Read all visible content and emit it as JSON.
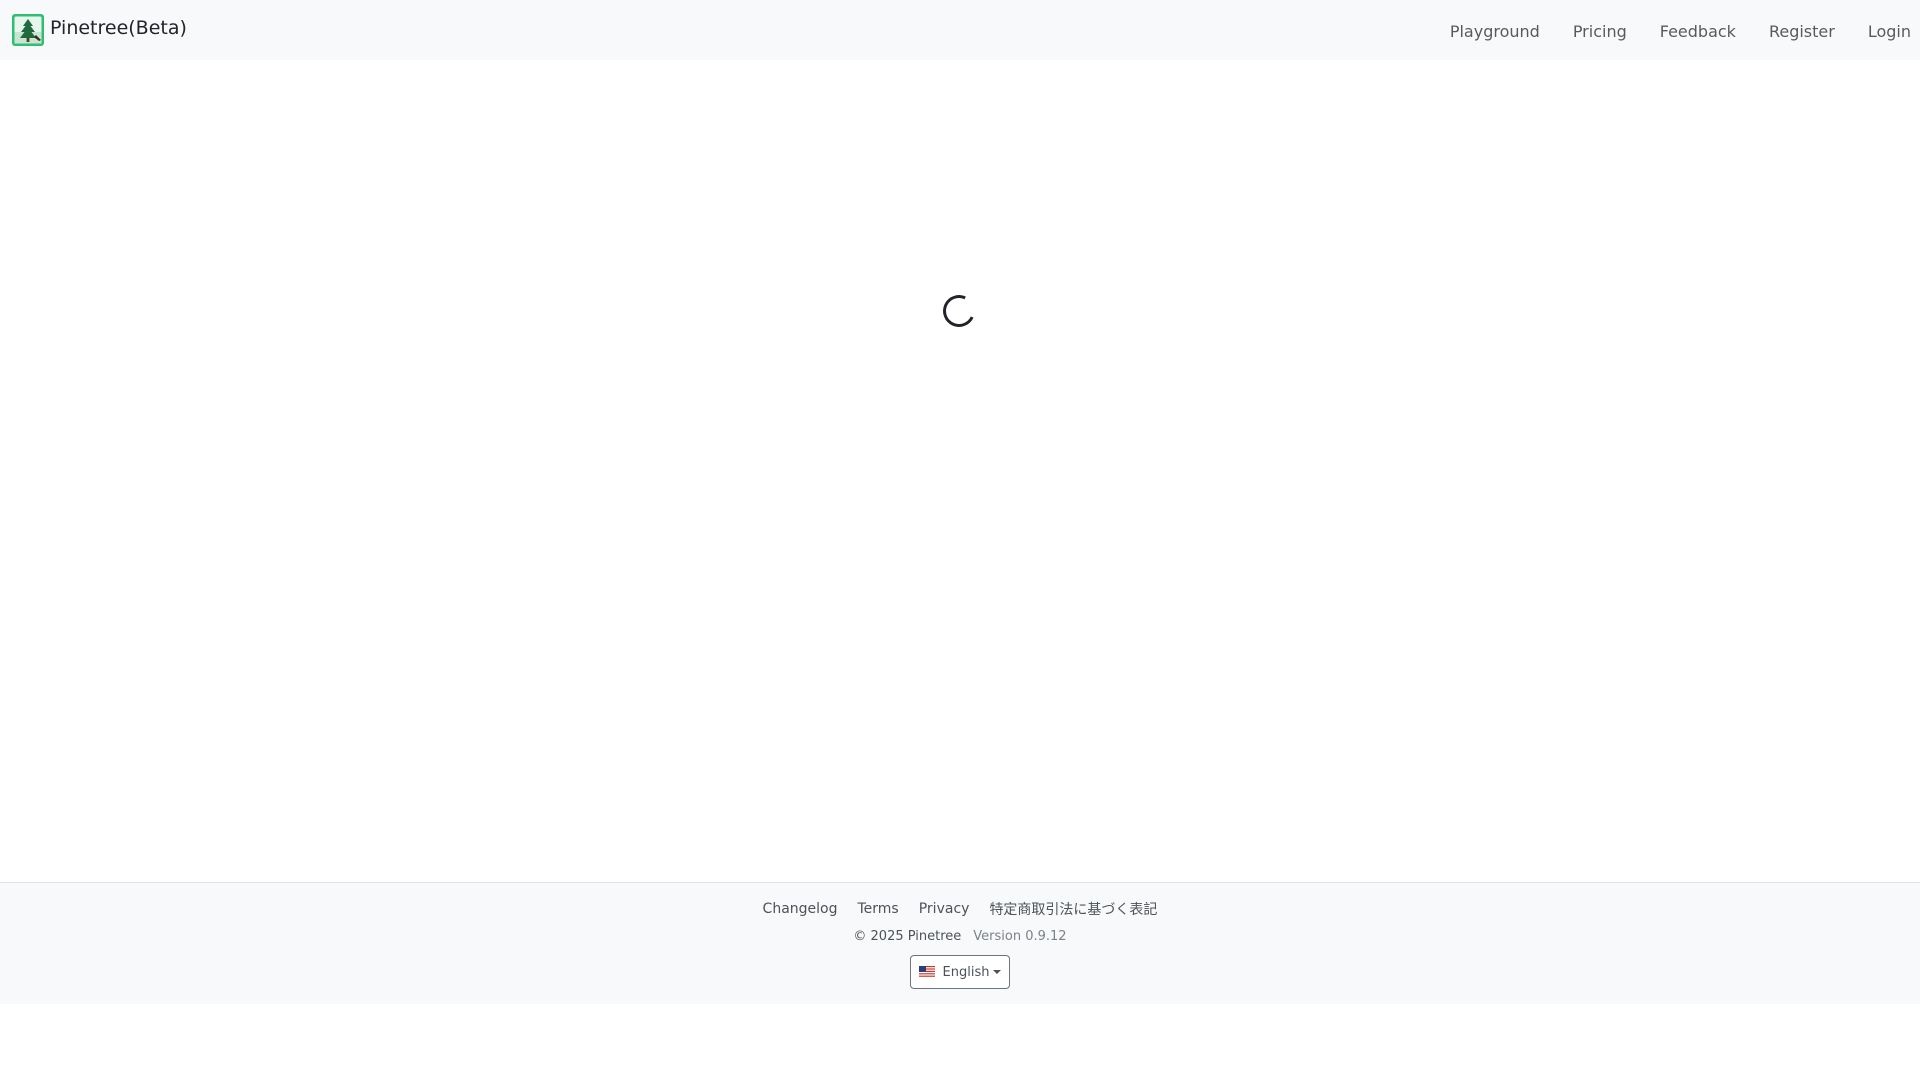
{
  "navbar": {
    "brand": "Pinetree(Beta)",
    "links": [
      {
        "label": "Playground"
      },
      {
        "label": "Pricing"
      },
      {
        "label": "Feedback"
      },
      {
        "label": "Register"
      },
      {
        "label": "Login"
      }
    ]
  },
  "main": {
    "loading_icon": "loading-spinner-icon"
  },
  "footer": {
    "links": [
      {
        "label": "Changelog"
      },
      {
        "label": "Terms"
      },
      {
        "label": "Privacy"
      },
      {
        "label": "特定商取引法に基づく表記"
      }
    ],
    "copyright": "© 2025 Pinetree",
    "version": "Version 0.9.12",
    "language": {
      "selected": "English",
      "flag_icon": "us-flag-icon"
    }
  },
  "colors": {
    "navbar_bg": "#f8f9fa",
    "footer_bg": "#f8f9fa",
    "logo_green": "#2fbf71",
    "text": "#212529"
  }
}
